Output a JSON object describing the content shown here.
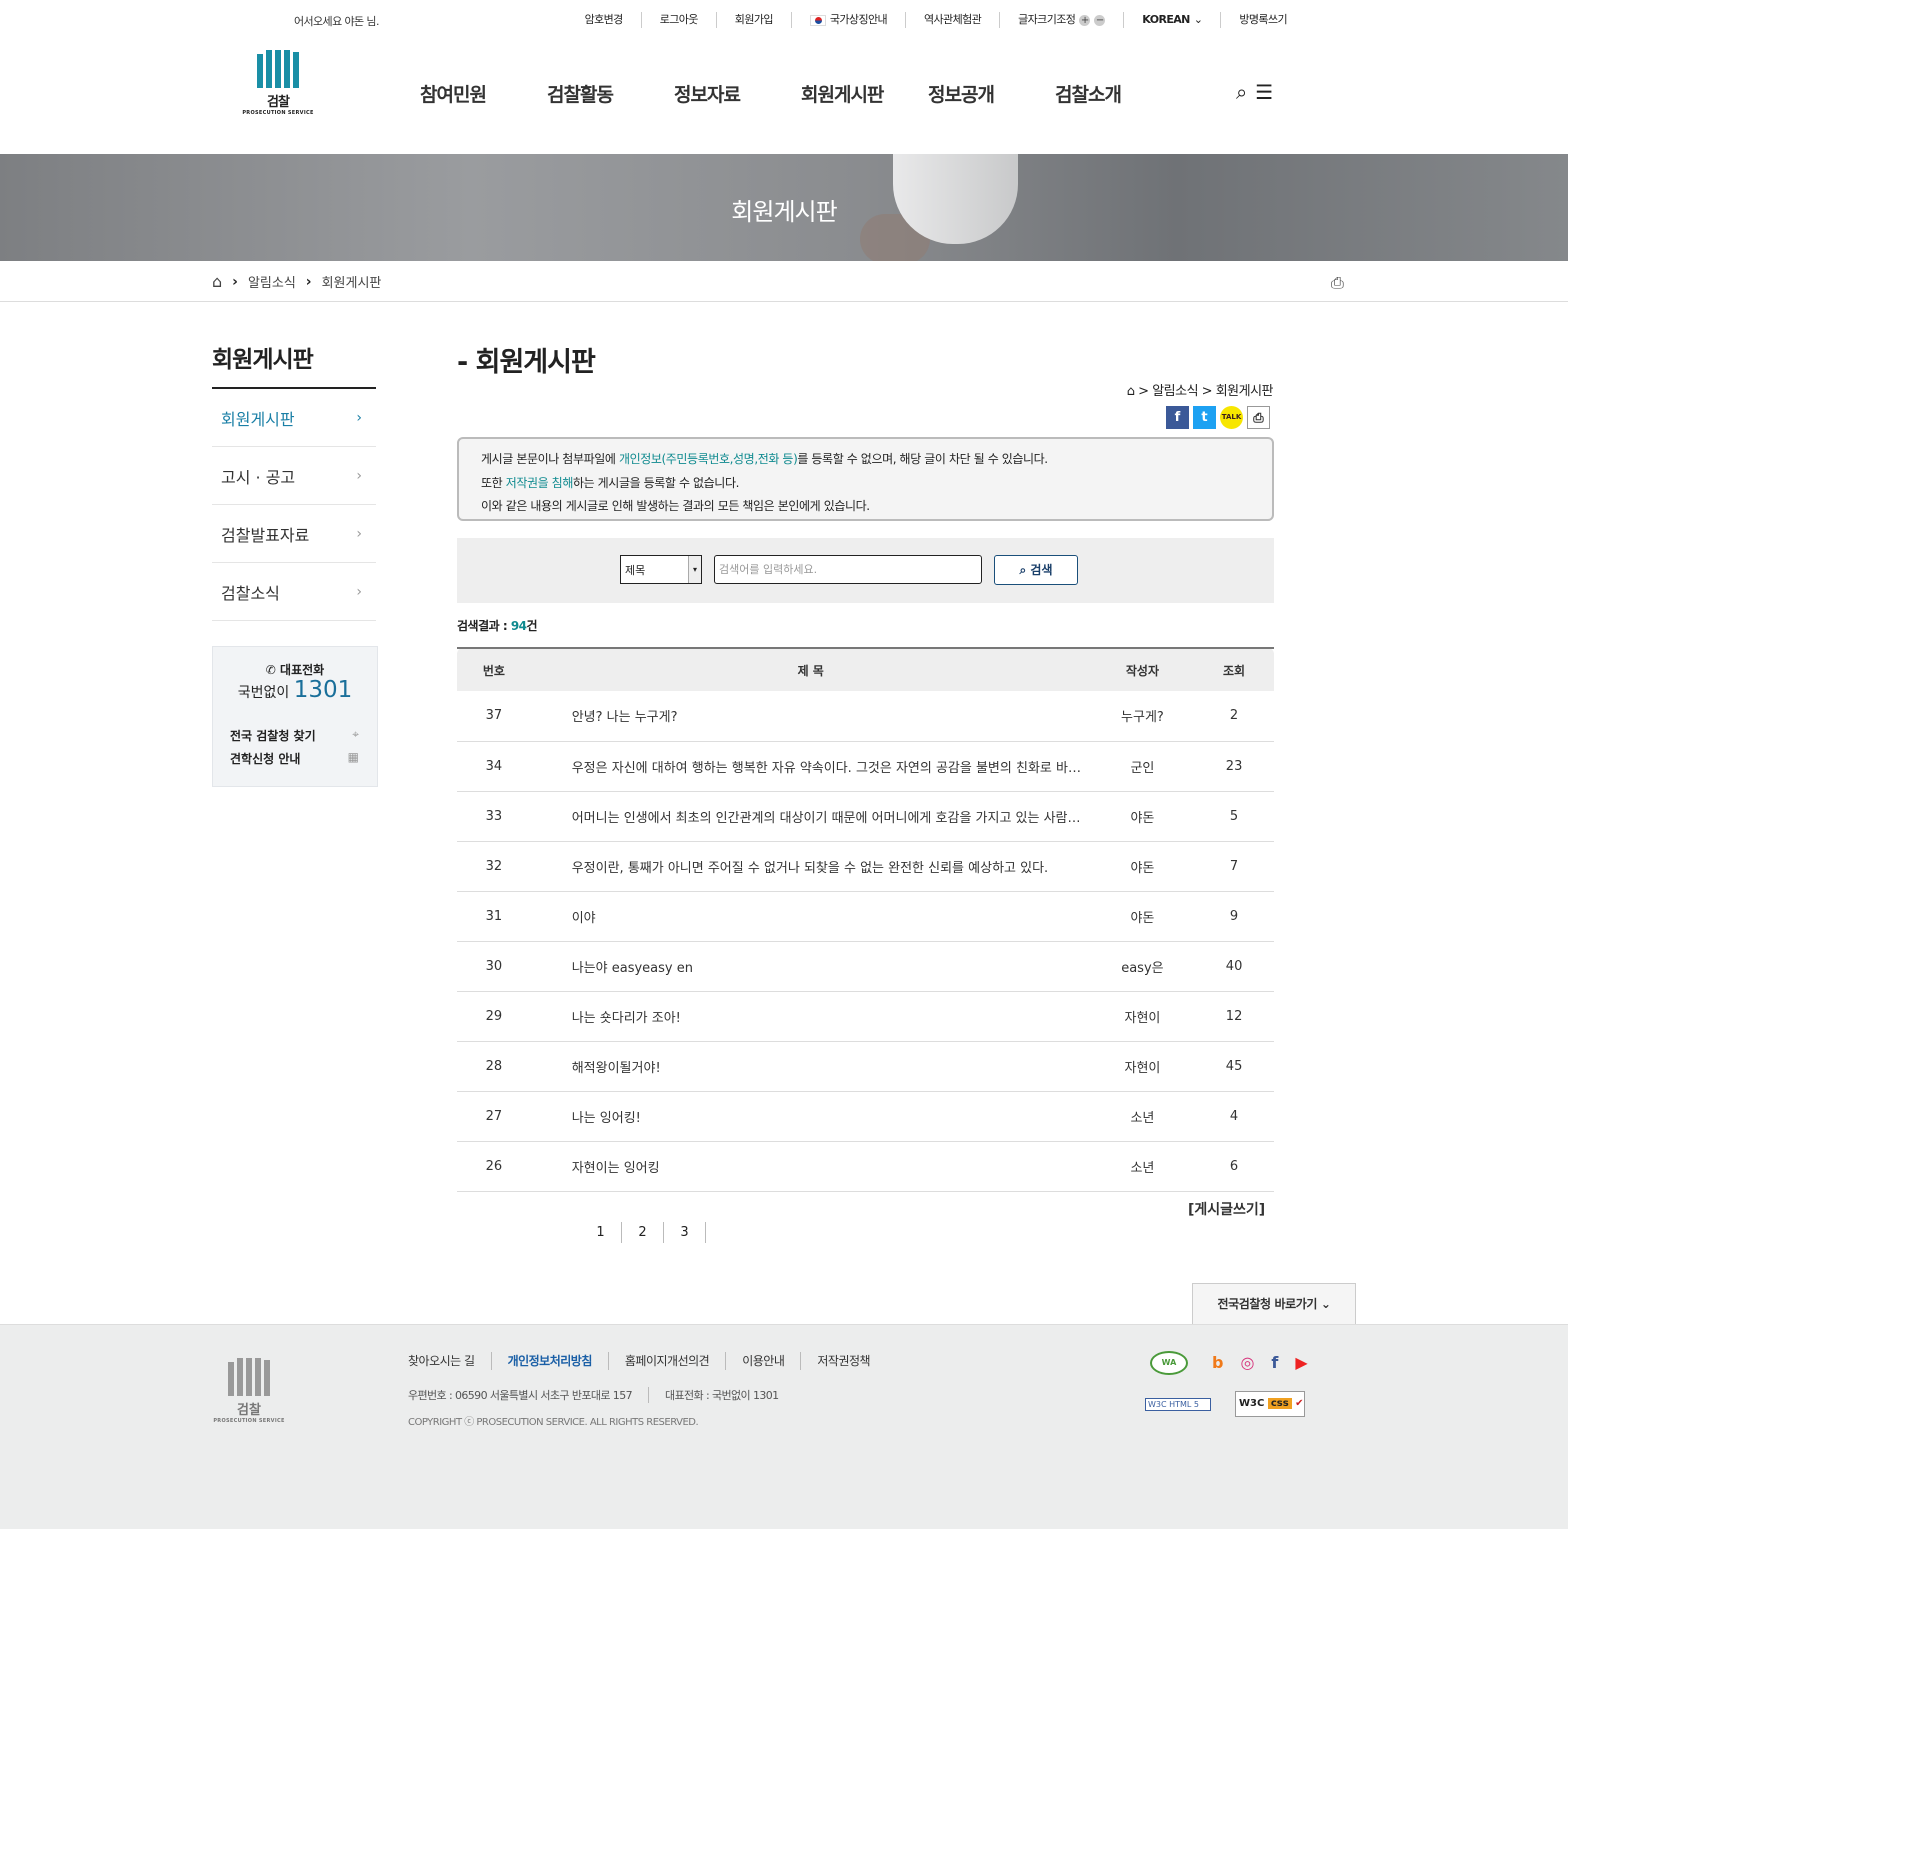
{
  "topbar": {
    "welcome": "어서오세요 야돈 님.",
    "utils": [
      {
        "label": "암호변경"
      },
      {
        "label": "로그아웃"
      },
      {
        "label": "회원가입"
      },
      {
        "label": "국가상징안내"
      },
      {
        "label": "역사관체험관"
      },
      {
        "label": "글자크기조정"
      },
      {
        "label": "KOREAN"
      },
      {
        "label": "방명록쓰기"
      }
    ],
    "font_plus": "+",
    "font_minus": "−",
    "lang_chevron": "⌄"
  },
  "logo": {
    "ko": "검찰",
    "en": "PROSECUTION SERVICE"
  },
  "gnb": [
    "참여민원",
    "검찰활동",
    "정보자료",
    "회원게시판",
    "정보공개",
    "검찰소개"
  ],
  "header_icons": {
    "search": "⌕",
    "menu": "☰"
  },
  "visual": {
    "title": "회원게시판"
  },
  "location": {
    "home_icon": "⌂",
    "sep": "›",
    "items": [
      "알림소식",
      "회원게시판"
    ],
    "print_icon": "⎙"
  },
  "lnb": {
    "title": "회원게시판",
    "items": [
      {
        "label": "회원게시판",
        "active": true
      },
      {
        "label": "고시 · 공고",
        "active": false
      },
      {
        "label": "검찰발표자료",
        "active": false
      },
      {
        "label": "검찰소식",
        "active": false
      }
    ],
    "arrow": "›"
  },
  "callbox": {
    "title": "대표전화",
    "phone_icon": "✆",
    "prefix": "국번없이",
    "number": "1301",
    "links": [
      {
        "label": "전국 검찰청 찾기",
        "icon": "⌖"
      },
      {
        "label": "견학신청 안내",
        "icon": "▦"
      }
    ]
  },
  "content": {
    "title": "- 회원게시판",
    "path_text": "⌂ > 알림소식 > 회원게시판",
    "sns": [
      "f",
      "t",
      "TALK",
      "⎙"
    ],
    "notice": {
      "line1_a": "게시글 본문이나 첨부파일에 ",
      "line1_hl": "개인정보(주민등록번호,성명,전화 등)",
      "line1_b": "를 등록할 수 없으며, 해당 글이 차단 될 수 있습니다.",
      "line2_a": "또한 ",
      "line2_hl": "저작권을 침해",
      "line2_b": "하는 게시글을 등록할 수 없습니다.",
      "line3": "이와 같은 내용의 게시글로 인해 발생하는 결과의 모든 책임은 본인에게 있습니다."
    },
    "search": {
      "select_value": "제목",
      "select_arrow": "▾",
      "placeholder": "검색어를 입력하세요.",
      "button": "⌕ 검색"
    },
    "result_label": "검색결과 : ",
    "result_count": "94",
    "result_unit": "건",
    "columns": [
      "번호",
      "제 목",
      "작성자",
      "조회"
    ],
    "rows": [
      {
        "no": "37",
        "title": "안녕? 나는 누구게?",
        "writer": "누구게?",
        "views": "2"
      },
      {
        "no": "34",
        "title": "우정은 자신에 대하여 행하는 행복한 자유 약속이다. 그것은 자연의 공감을 불변의 친화로 바꾼다. ...",
        "writer": "군인",
        "views": "23"
      },
      {
        "no": "33",
        "title": "어머니는 인생에서 최초의 인간관계의 대상이기 때문에 어머니에게 호감을 가지고 있는 사람은 대...",
        "writer": "야돈",
        "views": "5"
      },
      {
        "no": "32",
        "title": "우정이란, 통째가 아니면 주어질 수 없거나 되찾을 수 없는 완전한 신뢰를 예상하고 있다.",
        "writer": "야돈",
        "views": "7"
      },
      {
        "no": "31",
        "title": "이야",
        "writer": "야돈",
        "views": "9"
      },
      {
        "no": "30",
        "title": "나는야 easyeasy en",
        "writer": "easy은",
        "views": "40"
      },
      {
        "no": "29",
        "title": "나는 숏다리가 조아!",
        "writer": "자현이",
        "views": "12"
      },
      {
        "no": "28",
        "title": "해적왕이될거야!",
        "writer": "자현이",
        "views": "45"
      },
      {
        "no": "27",
        "title": "나는 잉어킹!",
        "writer": "소년",
        "views": "4"
      },
      {
        "no": "26",
        "title": "자현이는 잉어킹",
        "writer": "소년",
        "views": "6"
      }
    ],
    "write_button": "[게시글쓰기]",
    "pages": [
      "1",
      "2",
      "3"
    ],
    "goto_button": "전국검찰청 바로가기 ⌄"
  },
  "footer": {
    "logo_ko": "검찰",
    "logo_en": "PROSECUTION SERVICE",
    "links": [
      {
        "label": "찾아오시는 길",
        "emphasis": false
      },
      {
        "label": "개인정보처리방침",
        "emphasis": true
      },
      {
        "label": "홈페이지개선의견",
        "emphasis": false
      },
      {
        "label": "이용안내",
        "emphasis": false
      },
      {
        "label": "저작권정책",
        "emphasis": false
      }
    ],
    "address": "우편번호 : 06590 서울특별시 서초구 반포대로 157",
    "phone": "대표전화 : 국번없이 1301",
    "copyright": "COPYRIGHT ⓒ PROSECUTION SERVICE. ALL RIGHTS RESERVED.",
    "wa_mark": "WA",
    "sns_icons": [
      "b",
      "◎",
      "f",
      "▶"
    ],
    "w3c_html": "W3C HTML 5",
    "w3c_css": "W3C",
    "w3c_css_tag": "css"
  },
  "colors": {
    "accent": "#1a8fa6",
    "highlight": "#0f8a8f",
    "link_blue": "#1a5fa6"
  }
}
